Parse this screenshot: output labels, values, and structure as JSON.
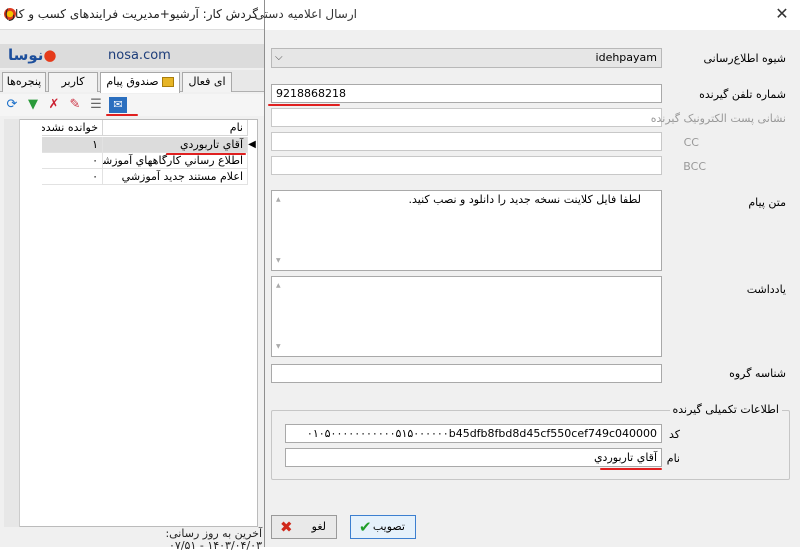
{
  "background": {
    "title": "گردش کار: آرشیو+مدیریت فرایندهای کسب و کار) - ت",
    "logo": "نوسا",
    "site": "nosa.com",
    "tabs": [
      "پنجره‌ها",
      "کاربر",
      "صندوق پیام",
      "ای فعال"
    ],
    "selected_tab": "صندوق پیام",
    "grid": {
      "columns": [
        "نام",
        "خوانده نشده"
      ],
      "rows": [
        {
          "name": "آقاي تاربوردي",
          "unread": "۱"
        },
        {
          "name": "اطلاع رساني كارگاههاي آموزشي",
          "unread": "۰"
        },
        {
          "name": "اعلام مستند جديد آموزشي",
          "unread": "۰"
        }
      ]
    },
    "status_line1": "آخرین به روز رسانی:",
    "status_line2": "۱۴۰۳/۰۴/۰۳ - ۰۷/۵۱"
  },
  "dialog": {
    "title": "ارسال اعلامیه دستی",
    "close": "✕",
    "channel_label": "شیوه اطلاع‌رسانی",
    "channel_value": "idehpayam",
    "phone_label": "شماره تلفن گیرنده",
    "phone_value": "9218868218",
    "email_label": "نشانی پست الکترونیک گیرنده",
    "cc_label": "CC",
    "bcc_label": "BCC",
    "message_label": "متن پیام",
    "message_value": "لطفا فایل کلاینت نسخه جدید را دانلود و نصب کنید.",
    "note_label": "یادداشت",
    "group_id_label": "شناسه گروه",
    "extra_title": "اطلاعات تکمیلی گیرنده",
    "code_label": "کد",
    "code_value": "۰۱۰۵۰۰۰۰۰۰۰۰۰۰۰۵۱۵۰۰۰۰۰۰b45dfb8fbd8d45cf550cef749c040000",
    "name_label": "نام",
    "name_value": "آقاي تاربوردي",
    "approve_button": "تصویب",
    "cancel_button": "لغو"
  },
  "colors": {
    "annotation": "#e02020",
    "approve_check": "#1f9e2b",
    "cancel_x": "#d0281a",
    "logo_blue": "#1d4f9c",
    "logo_red": "#e53b1b"
  }
}
